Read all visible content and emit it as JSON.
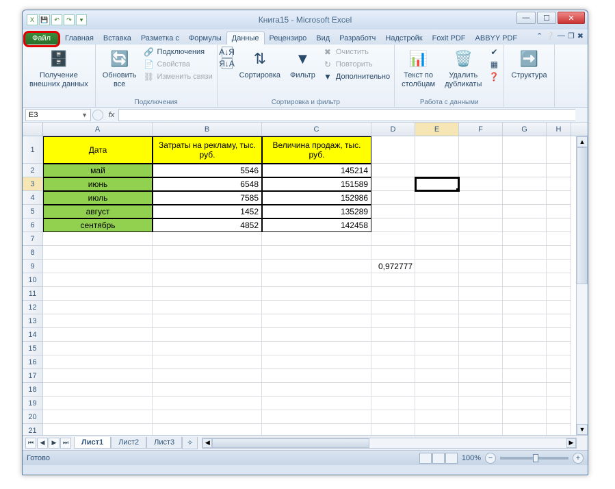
{
  "title": "Книга15  -  Microsoft Excel",
  "tabs": {
    "file": "Файл",
    "home": "Главная",
    "insert": "Вставка",
    "layout": "Разметка с",
    "formulas": "Формулы",
    "data": "Данные",
    "review": "Рецензиро",
    "view": "Вид",
    "developer": "Разработч",
    "addins": "Надстройк",
    "foxit": "Foxit PDF",
    "abbyy": "ABBYY PDF"
  },
  "ribbon": {
    "external": {
      "btn": "Получение\nвнешних данных",
      "label": ""
    },
    "connections": {
      "refresh": "Обновить\nвсе",
      "conn": "Подключения",
      "props": "Свойства",
      "links": "Изменить связи",
      "label": "Подключения"
    },
    "sort": {
      "sort": "Сортировка",
      "filter": "Фильтр",
      "clear": "Очистить",
      "reapply": "Повторить",
      "advanced": "Дополнительно",
      "label": "Сортировка и фильтр"
    },
    "tools": {
      "t2c": "Текст по\nстолбцам",
      "dedup": "Удалить\nдубликаты",
      "label": "Работа с данными"
    },
    "outline": {
      "btn": "Структура",
      "label": ""
    }
  },
  "namebox": "E3",
  "fx_label": "fx",
  "columns": [
    "A",
    "B",
    "C",
    "D",
    "E",
    "F",
    "G",
    "H"
  ],
  "headers": {
    "A": "Дата",
    "B": "Затраты на рекламу, тыс. руб.",
    "C": "Величина продаж, тыс. руб."
  },
  "rows": [
    {
      "A": "май",
      "B": "5546",
      "C": "145214"
    },
    {
      "A": "июнь",
      "B": "6548",
      "C": "151589"
    },
    {
      "A": "июль",
      "B": "7585",
      "C": "152986"
    },
    {
      "A": "август",
      "B": "1452",
      "C": "135289"
    },
    {
      "A": "сентябрь",
      "B": "4852",
      "C": "142458"
    }
  ],
  "d9": "0,972777",
  "sheets": [
    "Лист1",
    "Лист2",
    "Лист3"
  ],
  "status": "Готово",
  "zoom": "100%"
}
